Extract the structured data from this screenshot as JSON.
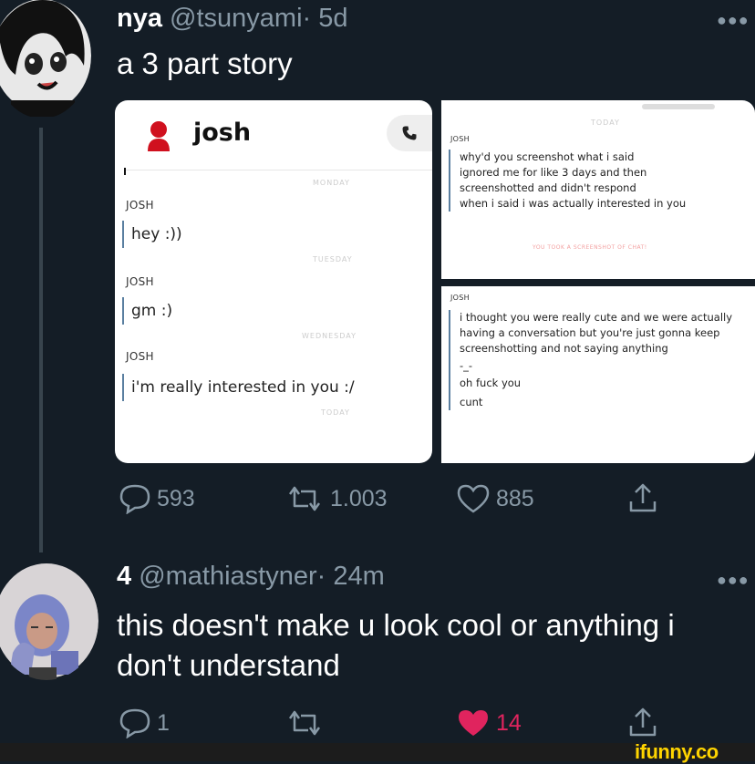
{
  "tweet": {
    "name": "nya",
    "handle": "@tsunyami",
    "time": "· 5d",
    "text": "a 3 part story",
    "image": {
      "left": {
        "contact": "josh",
        "days": [
          "MONDAY",
          "TUESDAY",
          "WEDNESDAY",
          "TODAY"
        ],
        "messages": [
          {
            "sender": "JOSH",
            "text": "hey :))"
          },
          {
            "sender": "JOSH",
            "text": "gm :)"
          },
          {
            "sender": "JOSH",
            "text": "i'm really interested in you :/"
          }
        ]
      },
      "right_top": {
        "day": "TODAY",
        "sender": "JOSH",
        "lines": [
          "why'd you screenshot what i said",
          "ignored me for like 3 days and then screenshotted and didn't respond",
          "when i said i was actually interested in you"
        ],
        "notice": "YOU TOOK A SCREENSHOT OF CHAT!"
      },
      "right_bottom": {
        "sender": "JOSH",
        "lines": [
          "i thought you were really cute and we were actually having a conversation but you're just gonna keep screenshotting and not saying anything",
          "-_-",
          "oh fuck you",
          "cunt"
        ]
      }
    },
    "actions": {
      "replies": "593",
      "retweets": "1.003",
      "likes": "885"
    }
  },
  "reply": {
    "name": "4",
    "handle": "@mathiastyner",
    "time": "· 24m",
    "text_line1": "this doesn't make u look cool or anything i",
    "text_line2": "don't understand",
    "actions": {
      "replies": "1",
      "likes": "14"
    }
  },
  "watermark": "ifunny.co",
  "colors": {
    "background": "#141d26",
    "muted": "#8899a6",
    "like": "#e0245e"
  }
}
